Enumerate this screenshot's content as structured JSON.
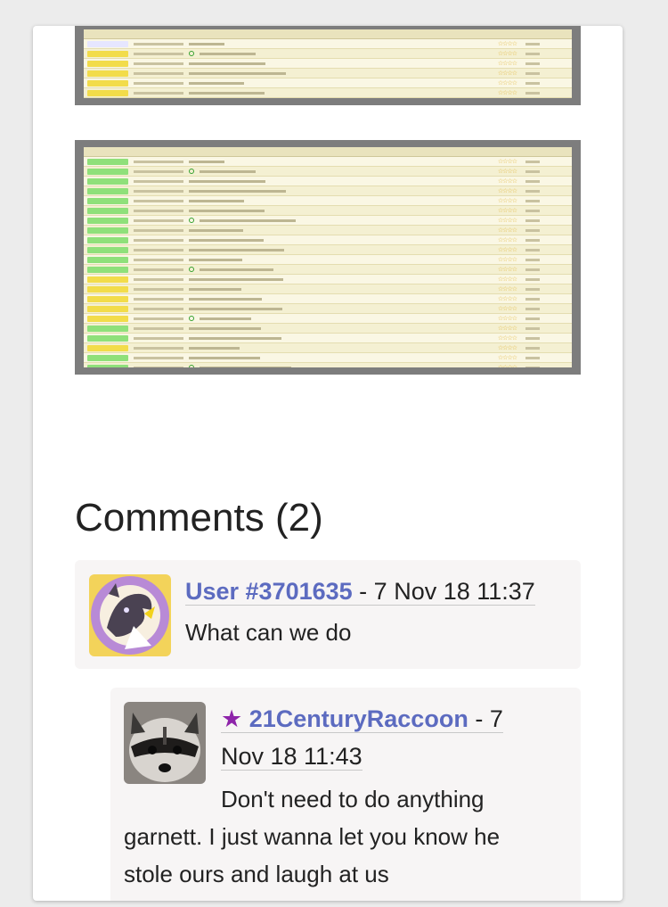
{
  "screenshots": {
    "top_rows": [
      {
        "tag": "other"
      },
      {
        "tag": "artist"
      },
      {
        "tag": "artist"
      },
      {
        "tag": "artist"
      },
      {
        "tag": "artist"
      },
      {
        "tag": "artist"
      },
      {
        "tag": "artist"
      },
      {
        "tag": "artist"
      }
    ],
    "bottom_rows": [
      {
        "tag": "western"
      },
      {
        "tag": "western"
      },
      {
        "tag": "western"
      },
      {
        "tag": "western"
      },
      {
        "tag": "western"
      },
      {
        "tag": "western"
      },
      {
        "tag": "western"
      },
      {
        "tag": "western"
      },
      {
        "tag": "western"
      },
      {
        "tag": "western"
      },
      {
        "tag": "western"
      },
      {
        "tag": "western"
      },
      {
        "tag": "artist"
      },
      {
        "tag": "artist"
      },
      {
        "tag": "artist"
      },
      {
        "tag": "artist"
      },
      {
        "tag": "artist"
      },
      {
        "tag": "western"
      },
      {
        "tag": "western"
      },
      {
        "tag": "artist"
      },
      {
        "tag": "western"
      },
      {
        "tag": "western"
      },
      {
        "tag": "western"
      },
      {
        "tag": "artist"
      },
      {
        "tag": "artist"
      }
    ]
  },
  "comments": {
    "heading": "Comments (2)",
    "items": [
      {
        "user": "User #3701635",
        "separator": " - ",
        "timestamp": "7 Nov 18 11:37",
        "text": "What can we do"
      },
      {
        "star": "★",
        "user": "21CenturyRaccoon",
        "separator": " - ",
        "timestamp": "7 Nov 18 11:43",
        "text": "Don't need to do anything garnett. I just wanna let you know he stole ours and laugh at us"
      }
    ]
  },
  "colors": {
    "link": "#5c6bc0",
    "star": "#8e24aa",
    "western_tag": "#8fe07a",
    "artist_tag": "#f2dc4a"
  }
}
